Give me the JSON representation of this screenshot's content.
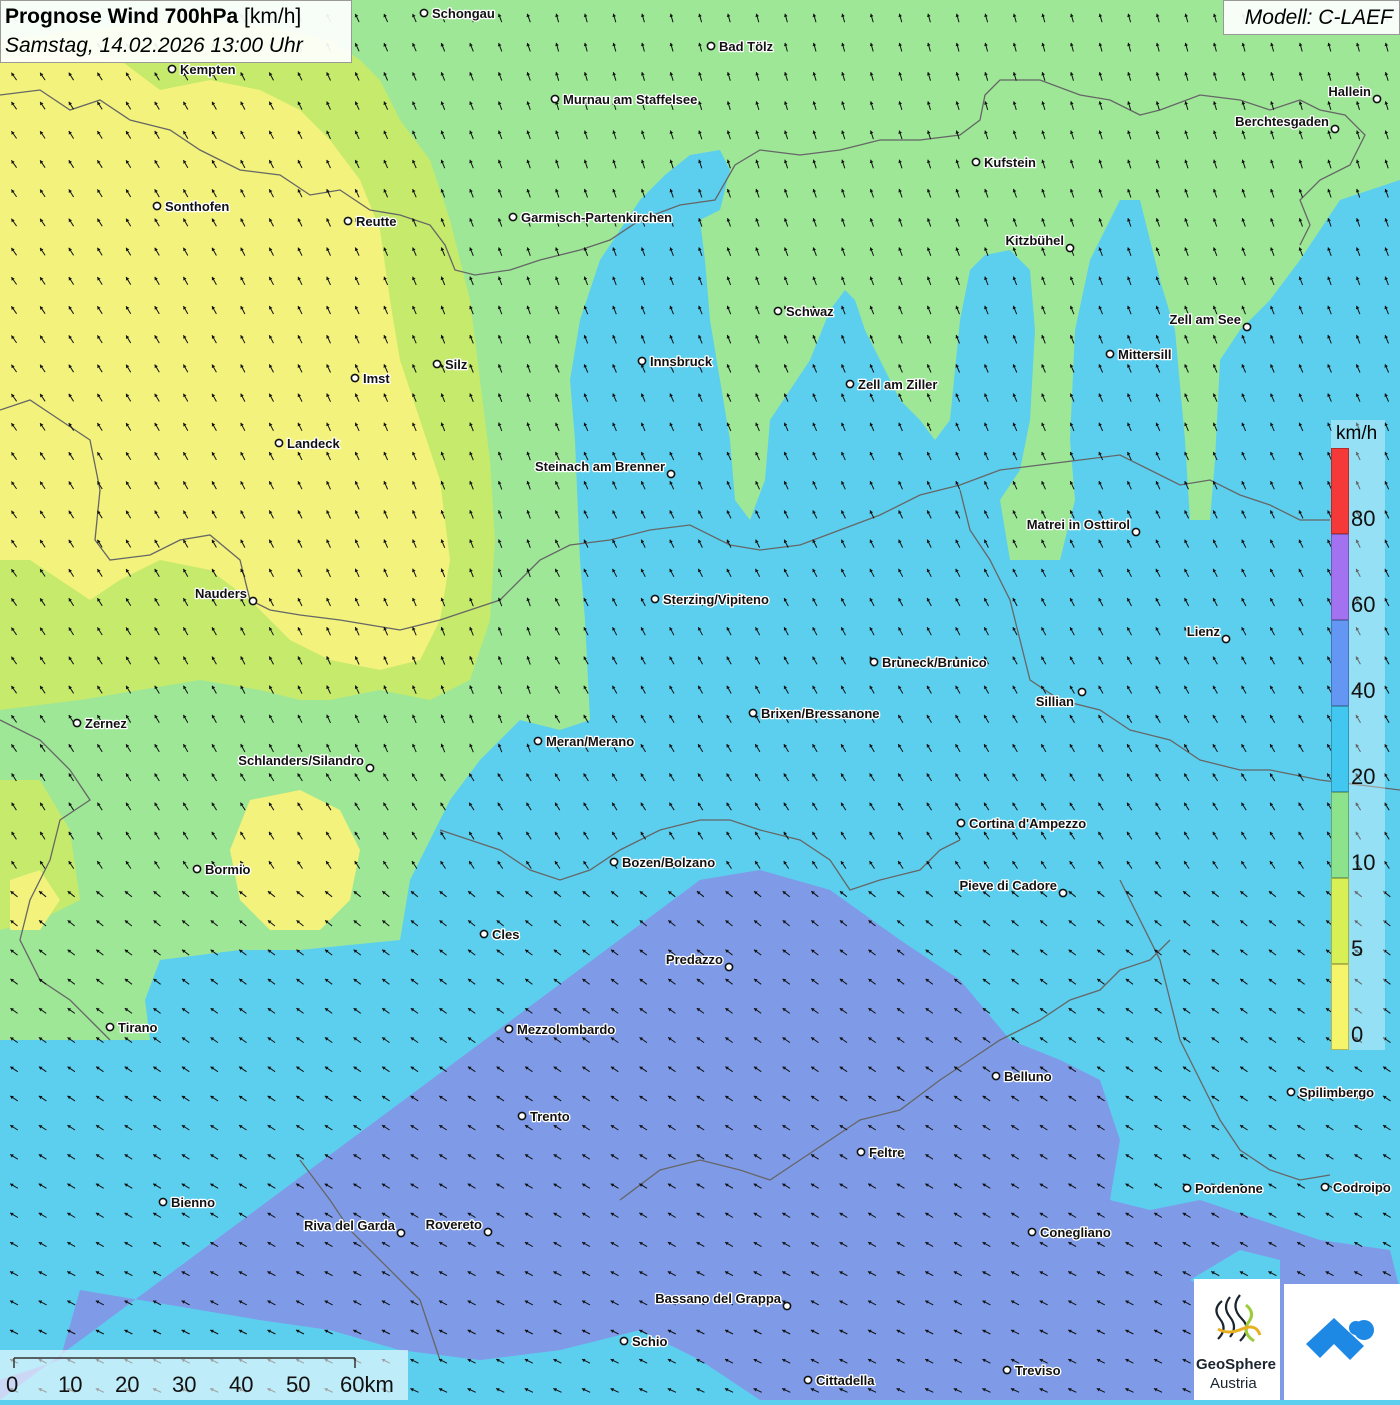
{
  "header": {
    "title_bold": "Prognose Wind 700hPa",
    "title_unit": " [km/h]",
    "subtitle": "Samstag, 14.02.2026 13:00 Uhr"
  },
  "model": {
    "label": "Modell: C-LAEF"
  },
  "legend": {
    "unit": "km/h",
    "labels": [
      "80",
      "60",
      "40",
      "20",
      "10",
      "5",
      "0"
    ],
    "colors": [
      "#f53838",
      "#a272f0",
      "#6497f3",
      "#42c7f1",
      "#8ce38c",
      "#d8ef55",
      "#f5f46a"
    ]
  },
  "scale_bar": {
    "labels": [
      "0",
      "10",
      "20",
      "30",
      "40",
      "50",
      "60km"
    ]
  },
  "logo": {
    "name": "GeoSphere",
    "sub": "Austria"
  },
  "map_colors": {
    "speed_0_5": "#f2f27c",
    "speed_5_10": "#c5ea6c",
    "speed_10_20": "#9de797",
    "speed_20_40": "#5ccfee",
    "speed_40_60": "#7f9be8",
    "border": "#666666",
    "wind_arrow": "#111111"
  },
  "cities": [
    {
      "name": "Schongau"
    },
    {
      "name": "Bad Tölz"
    },
    {
      "name": "Kempten"
    },
    {
      "name": "Murnau am Staffelsee"
    },
    {
      "name": "Hallein"
    },
    {
      "name": "Berchtesgaden"
    },
    {
      "name": "Kufstein"
    },
    {
      "name": "Sonthofen"
    },
    {
      "name": "Reutte"
    },
    {
      "name": "Garmisch-Partenkirchen"
    },
    {
      "name": "Kitzbühel"
    },
    {
      "name": "Schwaz"
    },
    {
      "name": "Zell am See"
    },
    {
      "name": "Mittersill"
    },
    {
      "name": "Silz"
    },
    {
      "name": "Innsbruck"
    },
    {
      "name": "Imst"
    },
    {
      "name": "Zell am Ziller"
    },
    {
      "name": "Landeck"
    },
    {
      "name": "Steinach am Brenner"
    },
    {
      "name": "Matrei in Osttirol"
    },
    {
      "name": "Nauders"
    },
    {
      "name": "Sterzing/Vipiteno"
    },
    {
      "name": "Lienz"
    },
    {
      "name": "Bruneck/Brunico"
    },
    {
      "name": "Sillian"
    },
    {
      "name": "Zernez"
    },
    {
      "name": "Brixen/Bressanone"
    },
    {
      "name": "Meran/Merano"
    },
    {
      "name": "Schlanders/Silandro"
    },
    {
      "name": "Cortina d'Ampezzo"
    },
    {
      "name": "Bozen/Bolzano"
    },
    {
      "name": "Bormio"
    },
    {
      "name": "Pieve di Cadore"
    },
    {
      "name": "Cles"
    },
    {
      "name": "Predazzo"
    },
    {
      "name": "Tirano"
    },
    {
      "name": "Mezzolombardo"
    },
    {
      "name": "Belluno"
    },
    {
      "name": "Spilimbergo"
    },
    {
      "name": "Trento"
    },
    {
      "name": "Feltre"
    },
    {
      "name": "Pordenone"
    },
    {
      "name": "Codroipo"
    },
    {
      "name": "Bienno"
    },
    {
      "name": "Riva del Garda"
    },
    {
      "name": "Rovereto"
    },
    {
      "name": "Conegliano"
    },
    {
      "name": "Bassano del Grappa"
    },
    {
      "name": "Schio"
    },
    {
      "name": "Treviso"
    },
    {
      "name": "Cittadella"
    }
  ]
}
